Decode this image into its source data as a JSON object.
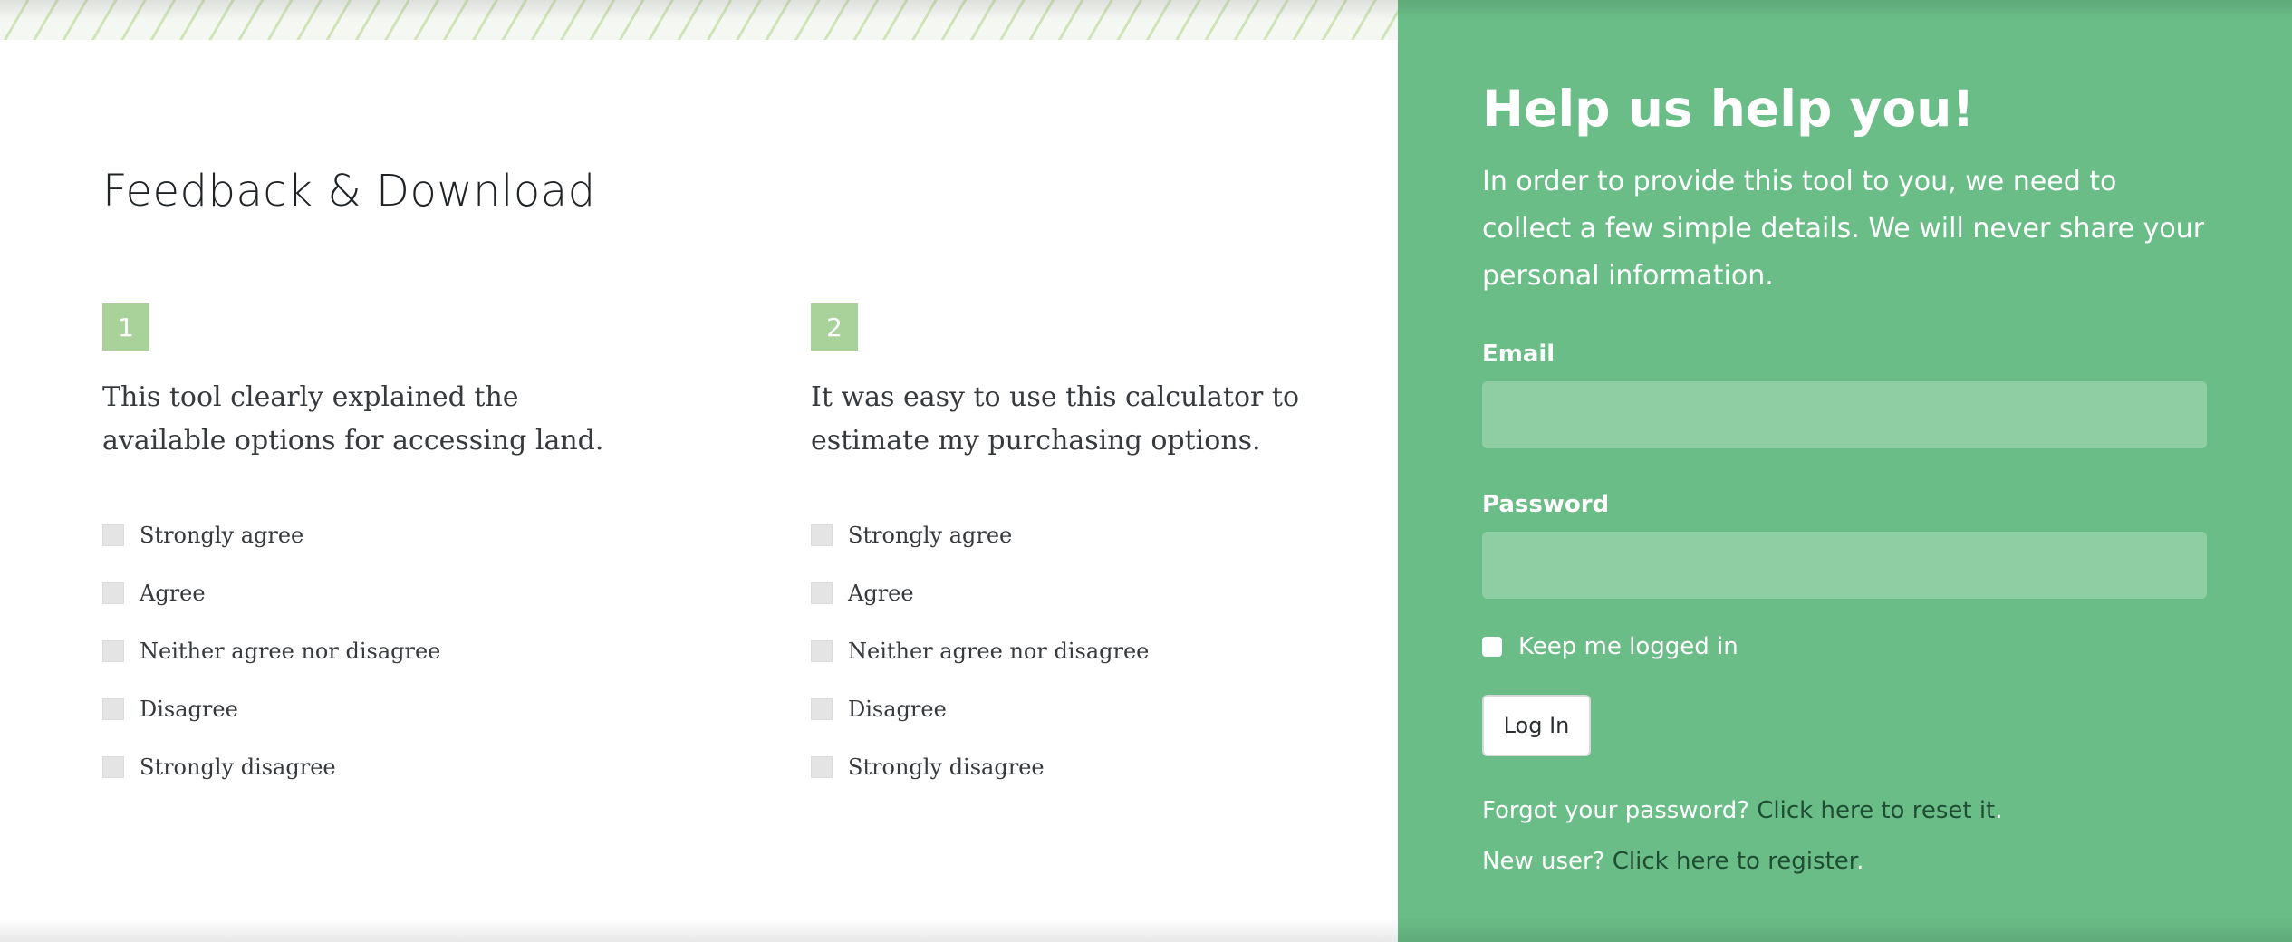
{
  "colors": {
    "accent_green": "#6abd87",
    "input_green": "#8fcea3",
    "badge_green": "#a9d29b",
    "link_dark_green": "#1f4d34"
  },
  "feedback": {
    "title": "Feedback & Download",
    "questions": [
      {
        "number": "1",
        "text": "This tool clearly explained the available options for accessing land.",
        "options": [
          "Strongly agree",
          "Agree",
          "Neither agree nor disagree",
          "Disagree",
          "Strongly disagree"
        ]
      },
      {
        "number": "2",
        "text": "It was easy to use this calculator to estimate my purchasing options.",
        "options": [
          "Strongly agree",
          "Agree",
          "Neither agree nor disagree",
          "Disagree",
          "Strongly disagree"
        ]
      }
    ]
  },
  "login": {
    "heading": "Help us help you!",
    "intro": "In order to provide this tool to you, we need to collect a few simple details. We will never share your personal information.",
    "email_label": "Email",
    "email_value": "",
    "password_label": "Password",
    "password_value": "",
    "remember_label": "Keep me logged in",
    "remember_checked": false,
    "login_button": "Log In",
    "forgot_text": "Forgot your password?",
    "forgot_link": "Click here to reset it",
    "new_user_text": "New user?",
    "register_link": "Click here to register",
    "period": "."
  }
}
